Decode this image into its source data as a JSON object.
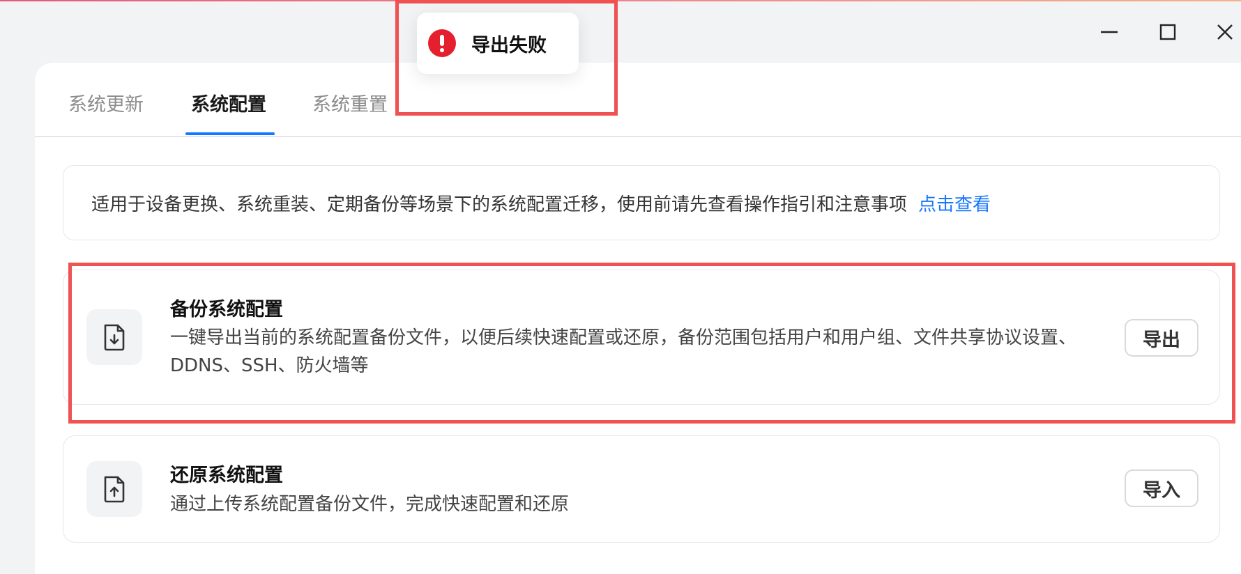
{
  "window": {
    "controls": [
      "minimize",
      "maximize",
      "close"
    ]
  },
  "tabs": [
    {
      "label": "系统更新",
      "active": false
    },
    {
      "label": "系统配置",
      "active": true
    },
    {
      "label": "系统重置",
      "active": false
    }
  ],
  "notice": {
    "text": "适用于设备更换、系统重装、定期备份等场景下的系统配置迁移，使用前请先查看操作指引和注意事项",
    "link": "点击查看"
  },
  "backup": {
    "title": "备份系统配置",
    "description": "一键导出当前的系统配置备份文件，以便后续快速配置或还原，备份范围包括用户和用户组、文件共享协议设置、DDNS、SSH、防火墙等",
    "button": "导出",
    "icon": "file-download-icon"
  },
  "restore": {
    "title": "还原系统配置",
    "description": "通过上传系统配置备份文件，完成快速配置和还原",
    "button": "导入",
    "icon": "file-upload-icon"
  },
  "toast": {
    "message": "导出失败",
    "icon": "error-icon",
    "color": "#e5202e"
  },
  "colors": {
    "accent": "#1677ff",
    "highlight": "#f05151"
  }
}
